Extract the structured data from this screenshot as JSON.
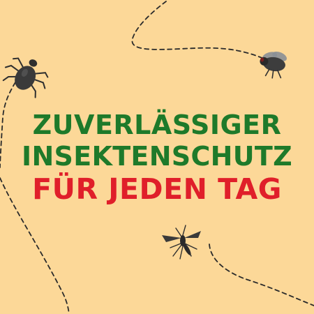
{
  "headline": {
    "line1": "ZUVERLÄSSIGER",
    "line2": "INSEKTENSCHUTZ",
    "line3": "FÜR JEDEN TAG"
  },
  "colors": {
    "background": "#fcd898",
    "headline_green": "#1e7a2a",
    "headline_red": "#e01f2a",
    "insect_dark": "#2f2f2f",
    "insect_mid": "#4a4a4a",
    "flight_path": "#2b2b2b"
  },
  "icons": [
    "tick-icon",
    "fly-icon",
    "mosquito-icon"
  ]
}
